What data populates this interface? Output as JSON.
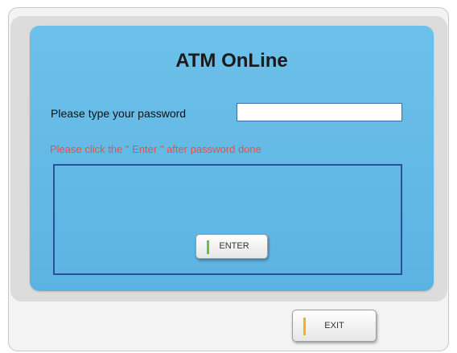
{
  "app": {
    "title": "ATM OnLine"
  },
  "form": {
    "password_label": "Please type your password",
    "password_value": "",
    "hint": "Please click the \" Enter \" after password done"
  },
  "buttons": {
    "enter_label": "ENTER",
    "exit_label": "EXIT"
  },
  "colors": {
    "panel": "#64baE6",
    "hint_text": "#e8504a",
    "enter_accent": "#6bbf3a",
    "exit_accent": "#f0b223",
    "box_border": "#2d4f9b"
  }
}
